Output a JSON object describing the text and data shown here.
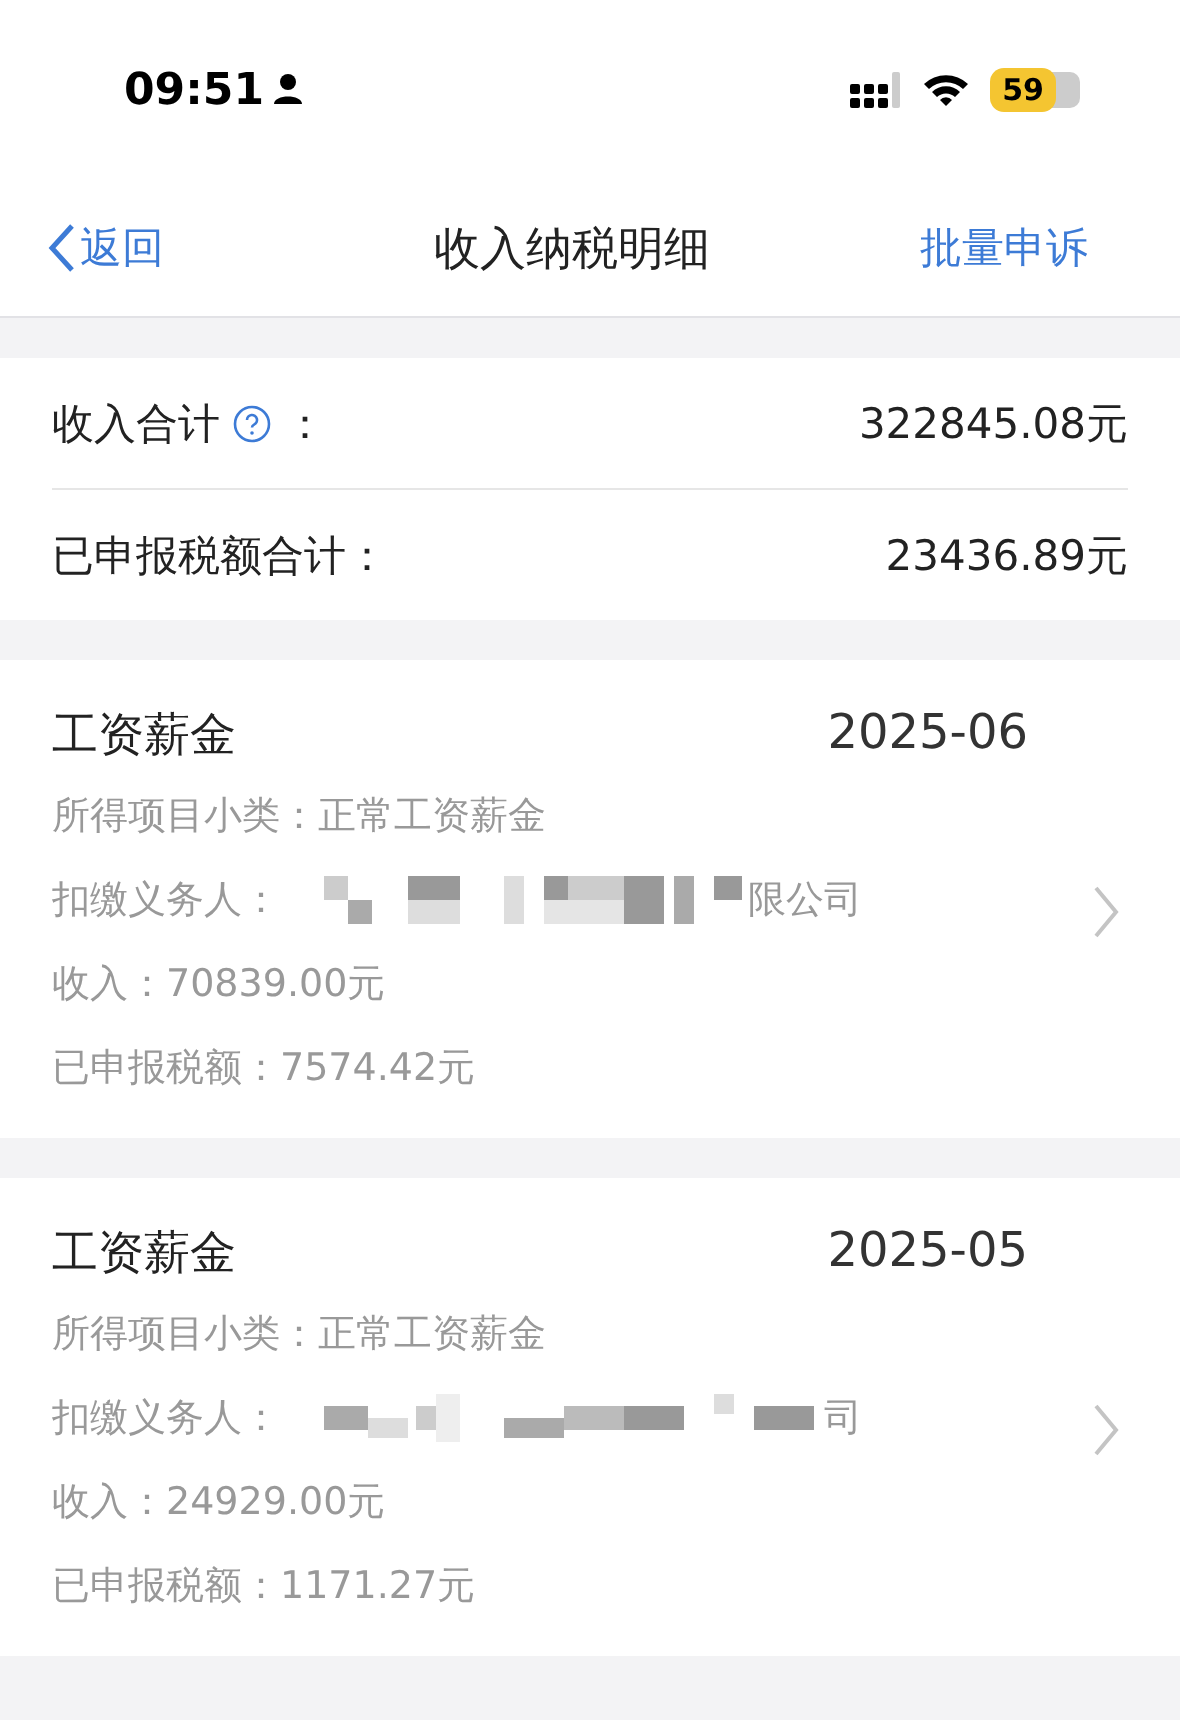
{
  "status_bar": {
    "time": "09:51",
    "battery": "59"
  },
  "nav": {
    "back": "返回",
    "title": "收入纳税明细",
    "action": "批量申诉"
  },
  "summary": [
    {
      "label": "收入合计",
      "help": true,
      "colon": "：",
      "value": "322845.08元"
    },
    {
      "label": "已申报税额合计：",
      "help": false,
      "value": "23436.89元"
    }
  ],
  "records": [
    {
      "category": "工资薪金",
      "period": "2025-06",
      "subcategory": "所得项目小类：正常工资薪金",
      "withholder_label": "扣缴义务人：",
      "withholder_visible": "限公司",
      "income": "收入：70839.00元",
      "tax": "已申报税额：7574.42元"
    },
    {
      "category": "工资薪金",
      "period": "2025-05",
      "subcategory": "所得项目小类：正常工资薪金",
      "withholder_label": "扣缴义务人：",
      "withholder_visible": "司",
      "income": "收入：24929.00元",
      "tax": "已申报税额：1171.27元"
    }
  ]
}
